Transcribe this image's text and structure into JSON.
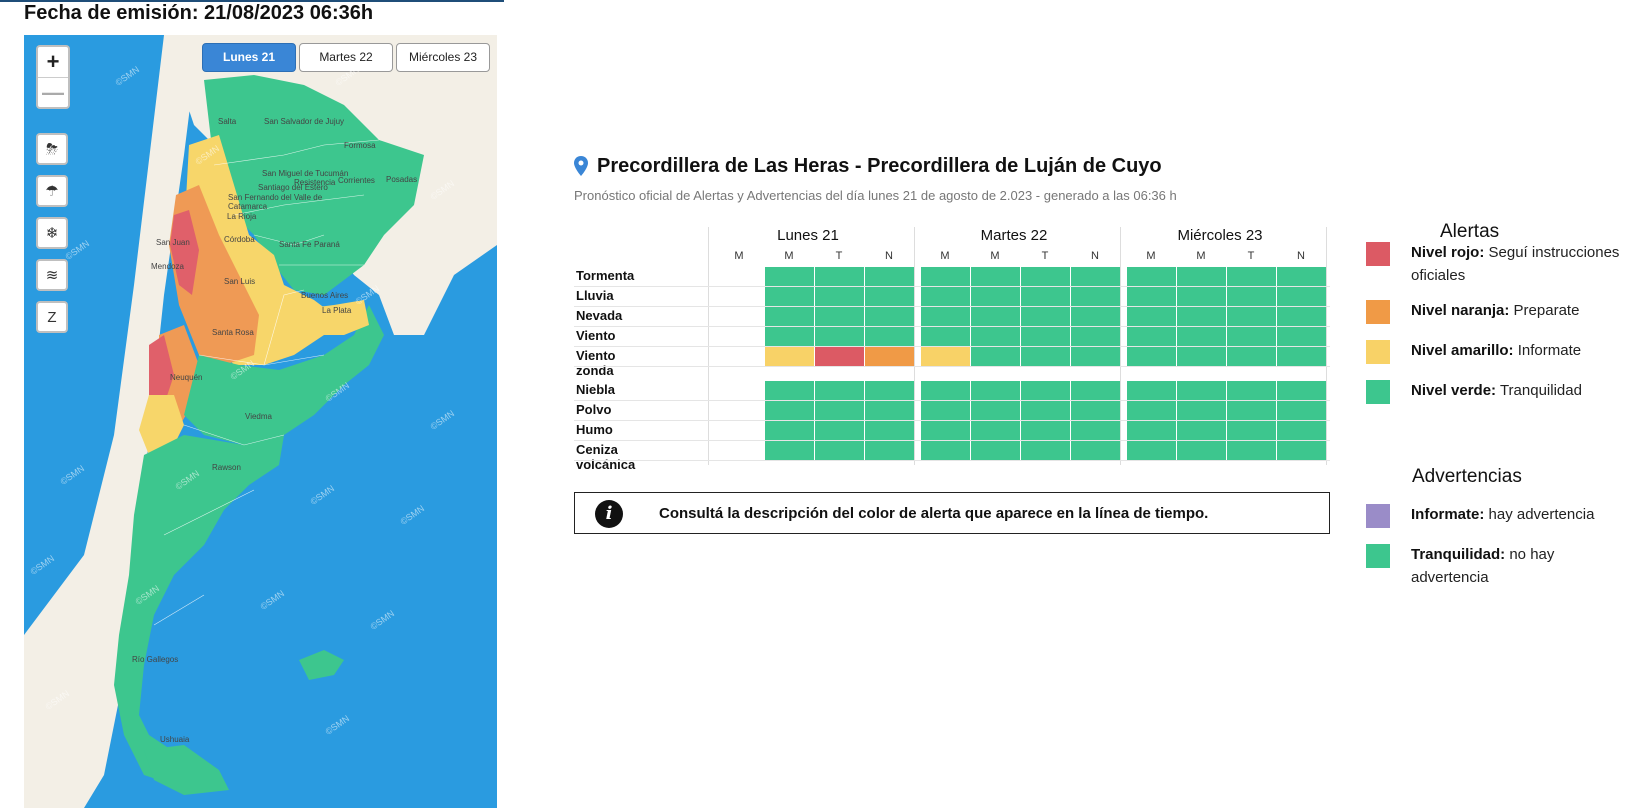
{
  "header": {
    "emision": "Fecha de emisión: 21/08/2023 06:36h"
  },
  "map": {
    "zoom_in": "+",
    "zoom_out": "—",
    "day_tabs": [
      "Lunes 21",
      "Martes 22",
      "Miércoles 23"
    ],
    "active_tab": 0,
    "tools": [
      "storm-icon",
      "rain-icon",
      "snow-icon",
      "wind-icon",
      "zonda-icon"
    ],
    "labels": {
      "salta": "Salta",
      "jujuy": "San Salvador de Jujuy",
      "formosa": "Formosa",
      "tucuman": "San Miguel de Tucumán",
      "resistencia": "Resistencia",
      "corrientes": "Corrientes",
      "posadas": "Posadas",
      "santiago": "Santiago del Estero",
      "catamarca": "San Fernando del Valle de Catamarca",
      "larioja": "La Rioja",
      "sanjuan": "San Juan",
      "cordoba": "Córdoba",
      "santafe": "Santa Fe",
      "parana": "Paraná",
      "mendoza": "Mendoza",
      "sanluis": "San Luis",
      "bsas": "Buenos Aires",
      "laplata": "La Plata",
      "santarosa": "Santa Rosa",
      "neuquen": "Neuquén",
      "viedma": "Viedma",
      "rawson": "Rawson",
      "riogallegos": "Río Gallegos",
      "ushuaia": "Ushuaia"
    },
    "watermark": "©SMN",
    "colors": {
      "sea": "#2a9be0",
      "land": "#f3efe6",
      "green": "#3dc68e",
      "yellow": "#f7d66a",
      "orange": "#ef9a55",
      "red": "#e0606a"
    }
  },
  "zone": {
    "title": "Precordillera de Las Heras - Precordillera de Luján de Cuyo",
    "subtitle": "Pronóstico oficial de Alertas y Advertencias del día lunes 21 de agosto de 2.023 - generado a las 06:36 h"
  },
  "timeline": {
    "days": [
      "Lunes 21",
      "Martes 22",
      "Miércoles 23"
    ],
    "slots": [
      "M",
      "M",
      "T",
      "N"
    ],
    "rows": [
      {
        "label": "Tormenta",
        "cells": [
          "",
          "verde",
          "verde",
          "verde",
          "verde",
          "verde",
          "verde",
          "verde",
          "verde",
          "verde",
          "verde",
          "verde"
        ]
      },
      {
        "label": "Lluvia",
        "cells": [
          "",
          "verde",
          "verde",
          "verde",
          "verde",
          "verde",
          "verde",
          "verde",
          "verde",
          "verde",
          "verde",
          "verde"
        ]
      },
      {
        "label": "Nevada",
        "cells": [
          "",
          "verde",
          "verde",
          "verde",
          "verde",
          "verde",
          "verde",
          "verde",
          "verde",
          "verde",
          "verde",
          "verde"
        ]
      },
      {
        "label": "Viento",
        "cells": [
          "",
          "verde",
          "verde",
          "verde",
          "verde",
          "verde",
          "verde",
          "verde",
          "verde",
          "verde",
          "verde",
          "verde"
        ]
      },
      {
        "label": "Viento zonda",
        "cells": [
          "",
          "amarillo",
          "rojo",
          "naranja",
          "amarillo",
          "verde",
          "verde",
          "verde",
          "verde",
          "verde",
          "verde",
          "verde"
        ]
      },
      {
        "label": "Niebla",
        "cells": [
          "",
          "verde",
          "verde",
          "verde",
          "verde",
          "verde",
          "verde",
          "verde",
          "verde",
          "verde",
          "verde",
          "verde"
        ]
      },
      {
        "label": "Polvo",
        "cells": [
          "",
          "verde",
          "verde",
          "verde",
          "verde",
          "verde",
          "verde",
          "verde",
          "verde",
          "verde",
          "verde",
          "verde"
        ]
      },
      {
        "label": "Humo",
        "cells": [
          "",
          "verde",
          "verde",
          "verde",
          "verde",
          "verde",
          "verde",
          "verde",
          "verde",
          "verde",
          "verde",
          "verde"
        ]
      },
      {
        "label": "Ceniza volcánica",
        "cells": [
          "",
          "verde",
          "verde",
          "verde",
          "verde",
          "verde",
          "verde",
          "verde",
          "verde",
          "verde",
          "verde",
          "verde"
        ]
      }
    ],
    "level_colors": {
      "verde": "#3dc68e",
      "amarillo": "#f8d267",
      "naranja": "#f09a46",
      "rojo": "#dc5a64",
      "violeta": "#9a8cc8"
    }
  },
  "note": {
    "icon": "info-icon",
    "text": "Consultá la descripción del color de alerta que aparece en la línea de tiempo."
  },
  "legend": {
    "alertas_title": "Alertas",
    "alertas": [
      {
        "color": "#dc5a64",
        "level": "Nivel rojo:",
        "desc": "Seguí instrucciones oficiales"
      },
      {
        "color": "#f09a46",
        "level": "Nivel naranja:",
        "desc": "Preparate"
      },
      {
        "color": "#f8d267",
        "level": "Nivel amarillo:",
        "desc": "Informate"
      },
      {
        "color": "#3dc68e",
        "level": "Nivel verde:",
        "desc": "Tranquilidad"
      }
    ],
    "advertencias_title": "Advertencias",
    "advertencias": [
      {
        "color": "#9a8cc8",
        "level": "Informate:",
        "desc": "hay advertencia"
      },
      {
        "color": "#3dc68e",
        "level": "Tranquilidad:",
        "desc": "no hay advertencia"
      }
    ]
  }
}
